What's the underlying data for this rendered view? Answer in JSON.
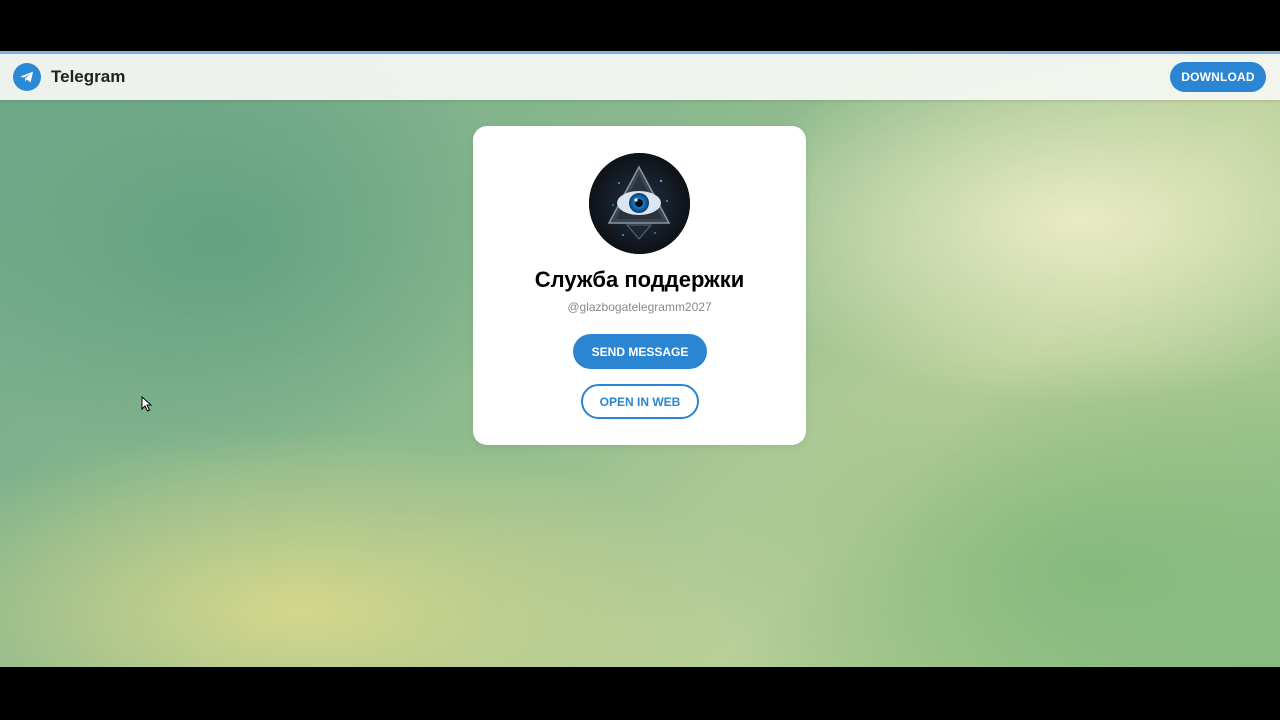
{
  "header": {
    "brand_name": "Telegram",
    "download_label": "DOWNLOAD"
  },
  "profile": {
    "title": "Служба поддержки",
    "username": "@glazbogatelegramm2027",
    "avatar_icon": "eye-pyramid-avatar"
  },
  "actions": {
    "send_message_label": "SEND MESSAGE",
    "open_in_web_label": "OPEN IN WEB"
  },
  "colors": {
    "accent": "#2a86d3",
    "card_bg": "#ffffff"
  }
}
